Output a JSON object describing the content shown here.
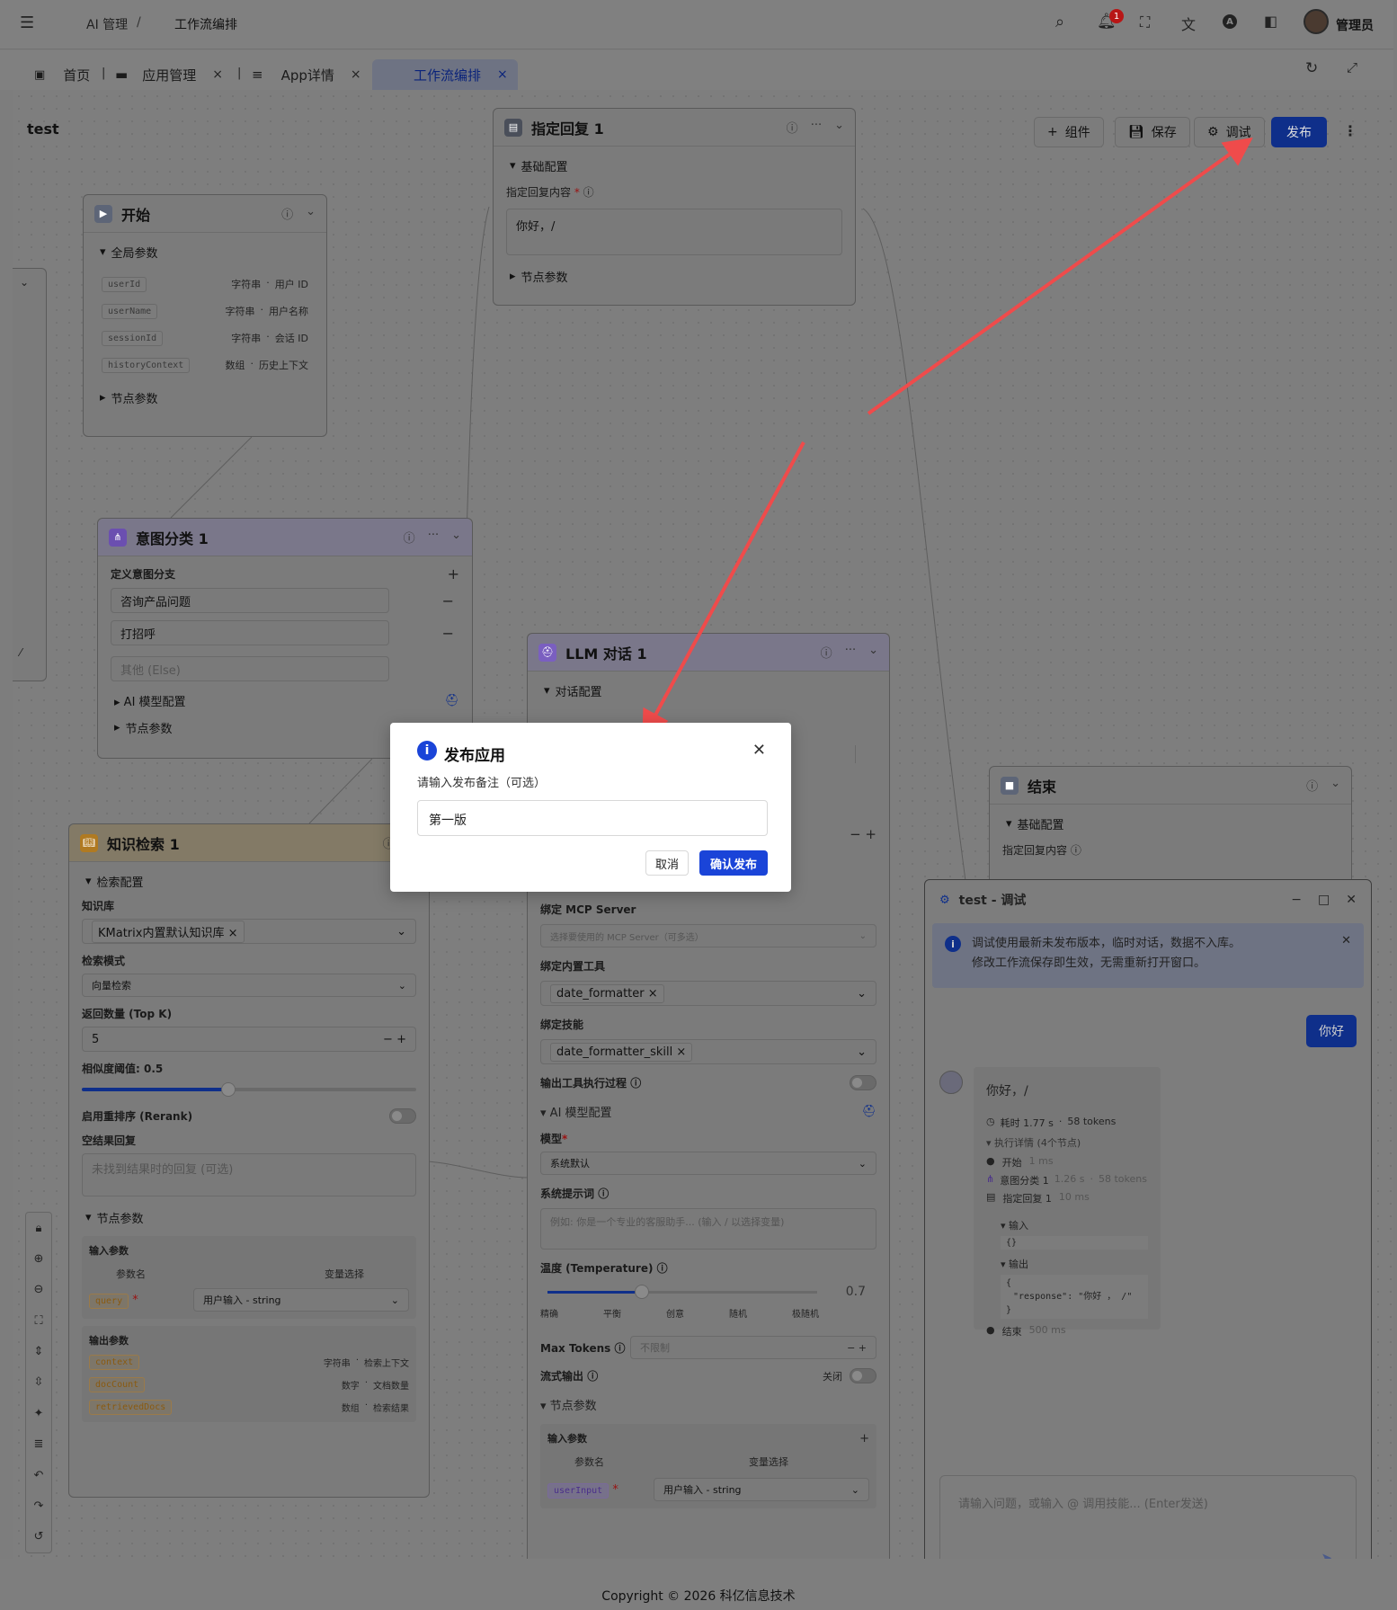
{
  "header": {
    "breadcrumb_1": "AI 管理",
    "breadcrumb_sep": "/",
    "breadcrumb_2": "工作流编排",
    "notif_count": "1",
    "user": "管理员"
  },
  "tabs": [
    {
      "label": "首页"
    },
    {
      "label": "应用管理",
      "close": "×"
    },
    {
      "label": "App详情",
      "close": "×"
    },
    {
      "label": "工作流编排",
      "close": "×"
    }
  ],
  "tab_sep": "|",
  "workflow": {
    "name": "test"
  },
  "toolbar": {
    "components": "组件",
    "save": "保存",
    "debug": "调试",
    "publish": "发布"
  },
  "nodes": {
    "start": {
      "title": "开始",
      "section": "全局参数",
      "params": [
        {
          "name": "userId",
          "type": "字符串",
          "dot": "·",
          "desc": "用户 ID"
        },
        {
          "name": "userName",
          "type": "字符串",
          "dot": "·",
          "desc": "用户名称"
        },
        {
          "name": "sessionId",
          "type": "字符串",
          "dot": "·",
          "desc": "会话 ID"
        },
        {
          "name": "historyContext",
          "type": "数组",
          "dot": "·",
          "desc": "历史上下文"
        }
      ],
      "node_params": "节点参数"
    },
    "reply": {
      "title": "指定回复 1",
      "section": "基础配置",
      "content_label": "指定回复内容",
      "required": "*",
      "content": "你好，/",
      "node_params": "节点参数"
    },
    "intent": {
      "title": "意图分类 1",
      "define": "定义意图分支",
      "branches": [
        "咨询产品问题",
        "打招呼"
      ],
      "else": "其他 (Else)",
      "ai_config": "AI 模型配置",
      "node_params": "节点参数"
    },
    "knowledge": {
      "title": "知识检索 1",
      "section": "检索配置",
      "kb_label": "知识库",
      "kb_value": "KMatrix内置默认知识库",
      "mode_label": "检索模式",
      "mode_value": "向量检索",
      "topk_label": "返回数量 (Top K)",
      "topk_value": "5",
      "sim_label": "相似度阈值: 0.5",
      "similarity": 0.5,
      "rerank_label": "启用重排序 (Rerank)",
      "empty_label": "空结果回复",
      "empty_placeholder": "未找到结果时的回复 (可选)",
      "node_params": "节点参数",
      "input_label": "输入参数",
      "col_name": "参数名",
      "col_var": "变量选择",
      "input_param": "query",
      "input_var": "用户输入 - string",
      "output_label": "输出参数",
      "outputs": [
        {
          "name": "context",
          "type": "字符串",
          "dot": "·",
          "desc": "检索上下文"
        },
        {
          "name": "docCount",
          "type": "数字",
          "dot": "·",
          "desc": "文档数量"
        },
        {
          "name": "retrievedDocs",
          "type": "数组",
          "dot": "·",
          "desc": "检索结果"
        }
      ]
    },
    "llm": {
      "title": "LLM 对话 1",
      "section": "对话配置",
      "mcp_label": "绑定 MCP Server",
      "mcp_placeholder": "选择要使用的 MCP Server（可多选）",
      "tools_label": "绑定内置工具",
      "tool_value": "date_formatter",
      "skill_label": "绑定技能",
      "skill_value": "date_formatter_skill",
      "output_proc_label": "输出工具执行过程",
      "ai_config": "AI 模型配置",
      "model_label": "模型",
      "model_value": "系统默认",
      "sys_prompt_label": "系统提示词",
      "sys_prompt_placeholder": "例如: 你是一个专业的客服助手... (输入 / 以选择变量)",
      "temp_label": "温度 (Temperature)",
      "temp_value": "0.7",
      "temperature": 0.7,
      "temp_marks": [
        "精确",
        "平衡",
        "创意",
        "随机",
        "极随机"
      ],
      "max_tokens_label": "Max Tokens",
      "max_tokens_placeholder": "不限制",
      "stream_label": "流式输出",
      "stream_state": "关闭",
      "node_params": "节点参数",
      "input_label": "输入参数",
      "col_name": "参数名",
      "col_var": "变量选择",
      "input_param": "userInput",
      "input_var": "用户输入 - string"
    },
    "end": {
      "title": "结束",
      "section": "基础配置",
      "content_label": "指定回复内容"
    }
  },
  "modal": {
    "title": "发布应用",
    "prompt": "请输入发布备注（可选）",
    "value": "第一版",
    "cancel": "取消",
    "confirm": "确认发布"
  },
  "debug": {
    "title": "test - 调试",
    "notice_1": "调试使用最新未发布版本，临时对话，数据不入库。",
    "notice_2": "修改工作流保存即生效，无需重新打开窗口。",
    "user_msg": "你好",
    "reply": "你好，/",
    "time": "耗时 1.77 s",
    "tokens": "58 tokens",
    "dot": "·",
    "detail": "执行详情 (4个节点)",
    "steps": [
      {
        "name": "开始",
        "time": "1 ms"
      },
      {
        "name": "意图分类 1",
        "time": "1.26 s",
        "tokens": "58 tokens"
      },
      {
        "name": "指定回复 1",
        "time": "10 ms"
      }
    ],
    "input_label": "输入",
    "input_json": "{}",
    "output_label": "输出",
    "output_json_1": "{",
    "output_json_2": "\"response\": \"你好 ， /\"",
    "output_json_3": "}",
    "end_step": {
      "name": "结束",
      "time": "500 ms"
    },
    "input_placeholder": "请输入问题，或输入 @ 调用技能... (Enter发送)"
  },
  "footer": "Copyright © 2026 科亿信息技术",
  "colors": {
    "publish": "#0f2f8a",
    "confirm": "#1a44d8",
    "arrow": "#ef4b4b",
    "info": "#1a44d8"
  }
}
